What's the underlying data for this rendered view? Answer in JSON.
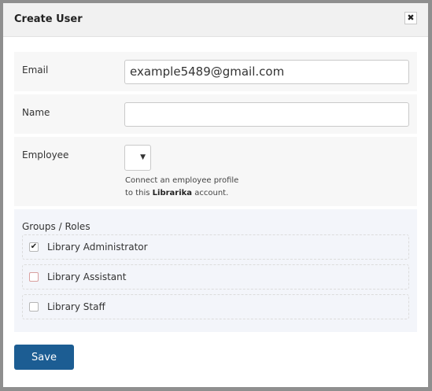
{
  "dialog": {
    "title": "Create User",
    "close_icon": "close-icon"
  },
  "form": {
    "email": {
      "label": "Email",
      "value": "example5489@gmail.com"
    },
    "name": {
      "label": "Name",
      "value": ""
    },
    "employee": {
      "label": "Employee",
      "selected": "",
      "help_line1": "Connect an employee profile",
      "help_prefix": "to this ",
      "help_brand": "Librarika",
      "help_suffix": " account."
    },
    "groups": {
      "label": "Groups / Roles",
      "items": [
        {
          "label": "Library Administrator",
          "checked": true
        },
        {
          "label": "Library Assistant",
          "checked": false
        },
        {
          "label": "Library Staff",
          "checked": false
        }
      ]
    }
  },
  "actions": {
    "save_label": "Save"
  },
  "colors": {
    "primary": "#1c5d93",
    "row_bg": "#f7f7f7",
    "groups_bg": "#f3f5fa"
  }
}
